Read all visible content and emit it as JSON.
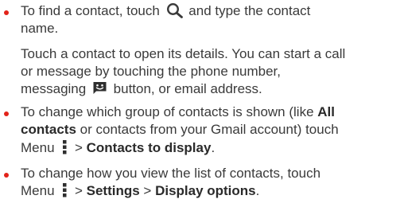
{
  "theme": {
    "bullet_color": "#e2231a",
    "text_color": "#3a3a3a"
  },
  "icons": {
    "search": "search-icon",
    "messaging": "message-bubble-icon",
    "menu": "menu-dots-icon"
  },
  "bullet1": {
    "line1_before": "To find a contact, touch ",
    "line1_after": " and type the contact",
    "line2": "name.",
    "para_line1": "Touch a contact to open its details. You can start a call",
    "para_line2": "or message by touching the phone number,",
    "para_line3_before": "messaging ",
    "para_line3_after": " button, or email address."
  },
  "bullet2": {
    "line1_before": "To change which group of contacts is shown (like ",
    "line1_bold": "All",
    "line2_bold": "contacts",
    "line2_after": " or contacts from your Gmail account) touch",
    "line3_before": "Menu ",
    "line3_mid": " > ",
    "line3_bold": "Contacts to display",
    "line3_after": "."
  },
  "bullet3": {
    "line1": "To change how you view the list of contacts, touch",
    "line2_before": "Menu ",
    "line2_sep1": " > ",
    "line2_bold1": "Settings",
    "line2_sep2": " > ",
    "line2_bold2": "Display options",
    "line2_after": "."
  }
}
